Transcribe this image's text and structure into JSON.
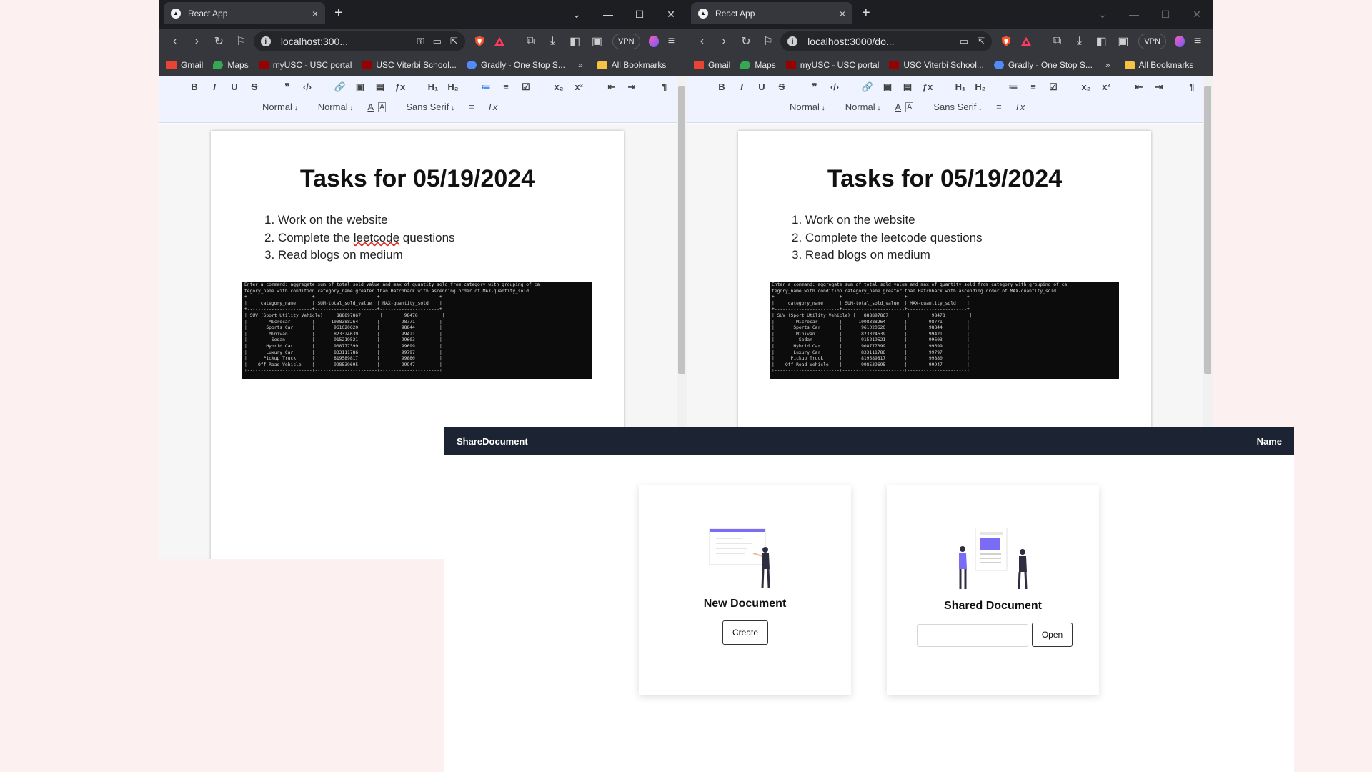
{
  "browser": {
    "tab_title": "React App",
    "tab_close": "×",
    "new_tab": "+",
    "window_controls": [
      "⌄",
      "—",
      "☐",
      "✕"
    ],
    "url_left": "localhost:300...",
    "url_right": "localhost:3000/do...",
    "vpn_label": "VPN",
    "bookmarks": [
      {
        "label": "Gmail",
        "color": "#ea4335"
      },
      {
        "label": "Maps",
        "color": "#34a853"
      },
      {
        "label": "myUSC - USC portal",
        "color": "#990000"
      },
      {
        "label": "USC Viterbi School...",
        "color": "#990000"
      },
      {
        "label": "Gradly - One Stop S...",
        "color": "#4f8cf7"
      }
    ],
    "bookmarks_more": "»",
    "all_bookmarks": "All Bookmarks"
  },
  "editor": {
    "toolbar_row1": [
      "B",
      "I",
      "U",
      "S",
      "❞",
      "‹/›",
      "🔗",
      "▣",
      "▤",
      "ƒx",
      "H₁",
      "H₂",
      "≔",
      "≡",
      "☑",
      "x₂",
      "x²",
      "⇤",
      "⇥",
      "¶"
    ],
    "header_select": "Normal",
    "size_select": "Normal",
    "font_select": "Sans Serif",
    "color_icon": "A",
    "bg_icon": "A",
    "align_icon": "≡",
    "clear_icon": "Tx",
    "doc_title": "Tasks for 05/19/2024",
    "tasks": [
      {
        "num": "1.",
        "pre": "Work on the website",
        "spell": "",
        "post": ""
      },
      {
        "num": "2.",
        "pre": "Complete the ",
        "spell": "leetcode",
        "post": " questions"
      },
      {
        "num": "3.",
        "pre": "Read blogs on medium",
        "spell": "",
        "post": ""
      }
    ],
    "terminal_text": "Enter a command: aggregate sum of total_sold_value and max of quantity_sold from category with grouping of ca\ntegory_name with condition category_name greater than Hatchback with ascending order of MAX-quantity_sold\n+------------------------+-----------------------+----------------------+\n|     category_name      | SUM-total_sold_value  | MAX-quantity_sold    |\n+------------------------+-----------------------+----------------------+\n| SUV (Sport Utility Vehicle) |   888897867       |        98478         |\n|        Microcar        |      1008388264       |        98771         |\n|       Sports Car       |       961020620       |        98844         |\n|        Minivan         |       823324639       |        99421         |\n|         Sedan          |       915219521       |        99603         |\n|       Hybrid Car       |       908777399       |        99699         |\n|       Luxury Car       |       833111786       |        99797         |\n|      Pickup Truck      |       819589817       |        99880         |\n|    Off-Road Vehicle    |       998539695       |        99947         |\n+------------------------+-----------------------+----------------------+"
  },
  "app": {
    "brand": "ShareDocument",
    "user": "Name",
    "new_doc_title": "New Document",
    "create_label": "Create",
    "shared_doc_title": "Shared Document",
    "open_label": "Open",
    "doc_id_value": ""
  }
}
